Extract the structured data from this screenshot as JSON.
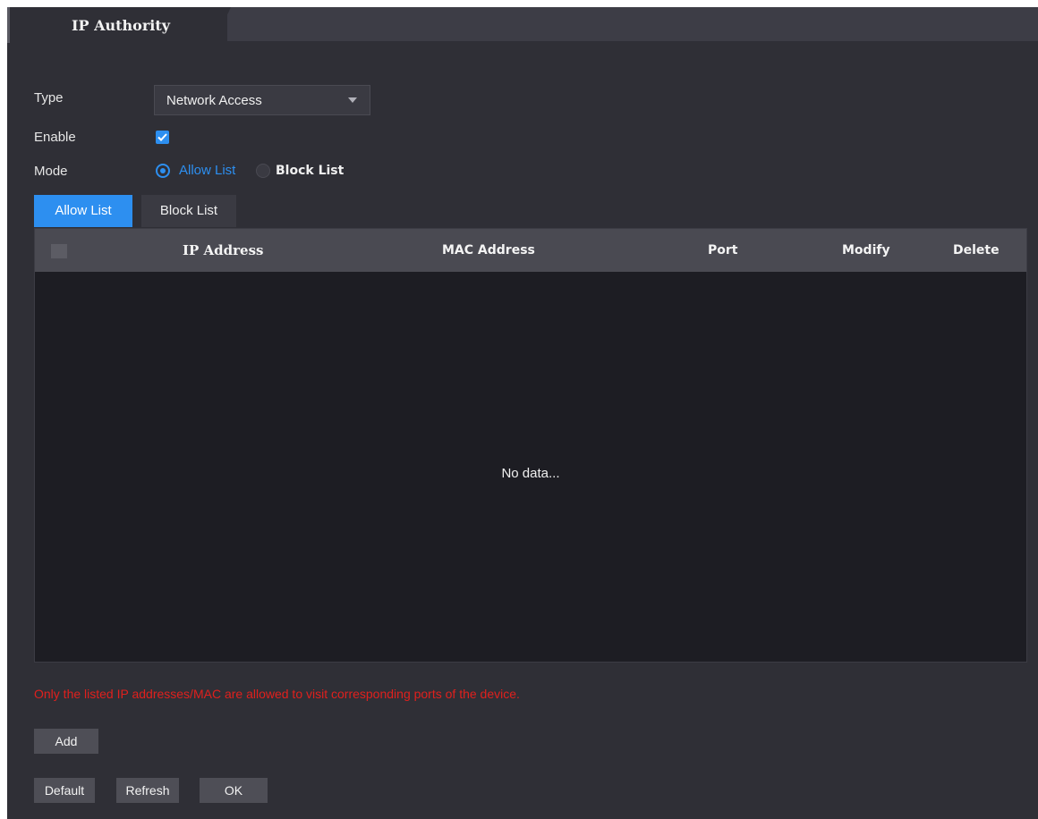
{
  "header": {
    "tab_title": "IP Authority"
  },
  "form": {
    "type_label": "Type",
    "type_value": "Network Access",
    "enable_label": "Enable",
    "enable_checked": true,
    "mode_label": "Mode",
    "mode_options": [
      "Allow List",
      "Block List"
    ],
    "mode_selected": "Allow List"
  },
  "subtabs": [
    "Allow List",
    "Block List"
  ],
  "table": {
    "columns": [
      "IP Address",
      "MAC Address",
      "Port",
      "Modify",
      "Delete"
    ],
    "empty_text": "No data..."
  },
  "hint": "Only the listed IP addresses/MAC are allowed to visit corresponding ports of the device.",
  "buttons": {
    "add": "Add",
    "default": "Default",
    "refresh": "Refresh",
    "ok": "OK"
  },
  "colors": {
    "accent": "#2d8ff0",
    "background": "#2f2f36",
    "table_body": "#1d1d23",
    "table_header": "#4a4a52",
    "warning_text": "#e0201d",
    "button": "#4e4e56"
  }
}
